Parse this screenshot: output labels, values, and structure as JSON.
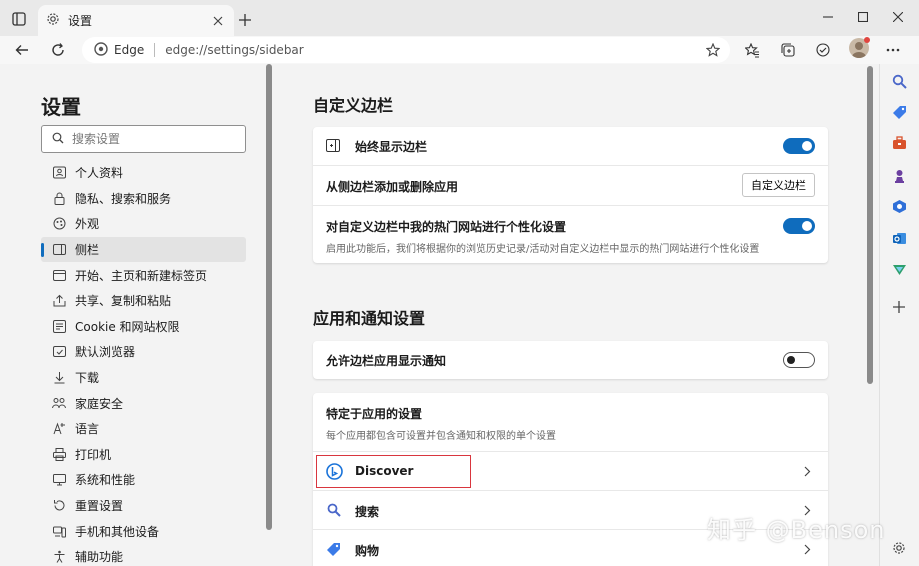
{
  "tab": {
    "title": "设置"
  },
  "address": {
    "site_label": "Edge",
    "url": "edge://settings/sidebar"
  },
  "nav": {
    "title": "设置",
    "search_placeholder": "搜索设置",
    "items": [
      {
        "label": "个人资料",
        "icon": "profile-icon"
      },
      {
        "label": "隐私、搜索和服务",
        "icon": "privacy-lock-icon"
      },
      {
        "label": "外观",
        "icon": "appearance-icon"
      },
      {
        "label": "侧栏",
        "icon": "sidebar-icon",
        "active": true
      },
      {
        "label": "开始、主页和新建标签页",
        "icon": "home-icon"
      },
      {
        "label": "共享、复制和粘贴",
        "icon": "share-icon"
      },
      {
        "label": "Cookie 和网站权限",
        "icon": "cookie-icon"
      },
      {
        "label": "默认浏览器",
        "icon": "browser-icon"
      },
      {
        "label": "下载",
        "icon": "download-icon"
      },
      {
        "label": "家庭安全",
        "icon": "family-icon"
      },
      {
        "label": "语言",
        "icon": "language-icon"
      },
      {
        "label": "打印机",
        "icon": "printer-icon"
      },
      {
        "label": "系统和性能",
        "icon": "system-icon"
      },
      {
        "label": "重置设置",
        "icon": "reset-icon"
      },
      {
        "label": "手机和其他设备",
        "icon": "phone-icon"
      },
      {
        "label": "辅助功能",
        "icon": "accessibility-icon"
      }
    ]
  },
  "customize": {
    "title": "自定义边栏",
    "always_show": "始终显示边栏",
    "add_remove": "从侧边栏添加或删除应用",
    "customize_button": "自定义边栏",
    "personalize": "对自定义边栏中我的热门网站进行个性化设置",
    "personalize_desc": "启用此功能后，我们将根据你的浏览历史记录/活动对自定义边栏中显示的热门网站进行个性化设置"
  },
  "notifications": {
    "title": "应用和通知设置",
    "allow": "允许边栏应用显示通知",
    "app_specific": "特定于应用的设置",
    "app_specific_desc": "每个应用都包含可设置并包含通知和权限的单个设置",
    "apps": [
      "Discover",
      "搜索",
      "购物"
    ]
  },
  "toggles": {
    "always_show": true,
    "personalize": true,
    "allow_notifications": false
  },
  "watermark": "知乎 @Benson",
  "colors": {
    "accent": "#0f6cbd",
    "highlight": "#d9363e"
  }
}
